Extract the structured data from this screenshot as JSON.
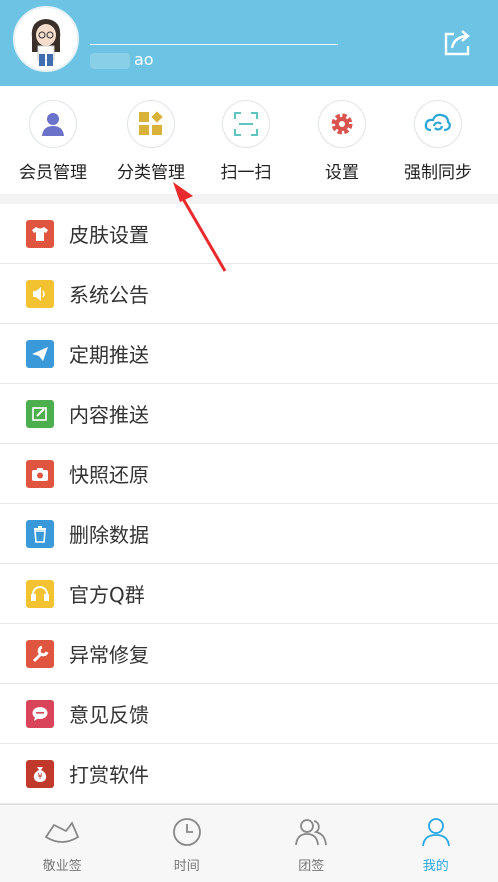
{
  "header": {
    "username_suffix": "ao"
  },
  "quick_actions": [
    {
      "label": "会员管理",
      "icon": "person-icon",
      "color": "#6a72c9"
    },
    {
      "label": "分类管理",
      "icon": "category-icon",
      "color": "#d9b23a"
    },
    {
      "label": "扫一扫",
      "icon": "scan-icon",
      "color": "#5fc5c0"
    },
    {
      "label": "设置",
      "icon": "gear-icon",
      "color": "#d9544f"
    },
    {
      "label": "强制同步",
      "icon": "sync-icon",
      "color": "#2aa6d8"
    }
  ],
  "menu": [
    {
      "label": "皮肤设置",
      "icon": "shirt-icon",
      "color": "#e0553f"
    },
    {
      "label": "系统公告",
      "icon": "speaker-icon",
      "color": "#f2c230"
    },
    {
      "label": "定期推送",
      "icon": "paper-plane-icon",
      "color": "#3a9ad9"
    },
    {
      "label": "内容推送",
      "icon": "edit-icon",
      "color": "#4cae4c"
    },
    {
      "label": "快照还原",
      "icon": "camera-icon",
      "color": "#e0553f"
    },
    {
      "label": "删除数据",
      "icon": "trash-icon",
      "color": "#3a9ad9"
    },
    {
      "label": "官方Q群",
      "icon": "headset-icon",
      "color": "#f2c230"
    },
    {
      "label": "异常修复",
      "icon": "wrench-icon",
      "color": "#e0553f"
    },
    {
      "label": "意见反馈",
      "icon": "chat-bubble-icon",
      "color": "#d9445a"
    },
    {
      "label": "打赏软件",
      "icon": "money-bag-icon",
      "color": "#c0392b"
    }
  ],
  "tabs": [
    {
      "label": "敬业签",
      "icon": "note-icon",
      "active": false
    },
    {
      "label": "时间",
      "icon": "clock-icon",
      "active": false
    },
    {
      "label": "团签",
      "icon": "team-icon",
      "active": false
    },
    {
      "label": "我的",
      "icon": "user-icon",
      "active": true
    }
  ],
  "colors": {
    "header_bg": "#6cc3e3",
    "tab_active": "#29a7e1",
    "arrow": "#e8292d"
  }
}
